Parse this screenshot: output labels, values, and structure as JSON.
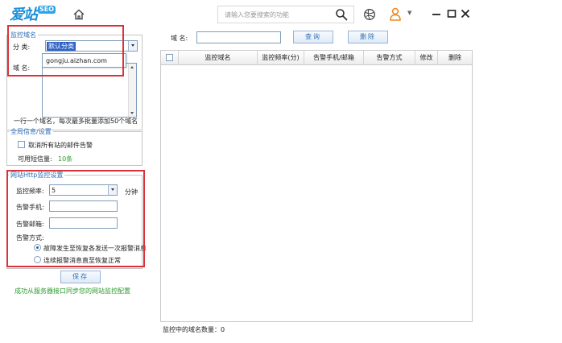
{
  "app": {
    "logo_text": "爱站",
    "logo_badge": "SEO",
    "search_placeholder": "请输入您要搜索的功能"
  },
  "left": {
    "group1": {
      "legend": "监控域名",
      "category_label": "分  类:",
      "category_value": "默认分类",
      "domain_label": "域  名:",
      "domain_suggestion": "gongju.aizhan.com",
      "hint": "一行一个域名，每次最多批量添加50个域名"
    },
    "group2": {
      "legend": "全局信息/设置",
      "cancel_alert_label": "取消所有站的邮件告警",
      "sms_label": "可用短信量:",
      "sms_value": "10条"
    },
    "group3": {
      "legend": "网站Http监控设置",
      "freq_label": "监控频率:",
      "freq_value": "5",
      "freq_unit": "分钟",
      "phone_label": "告警手机:",
      "email_label": "告警邮箱:",
      "mode_label": "告警方式:",
      "mode_option1": "故障发生至恢复各发送一次报警消息",
      "mode_option2": "连续报警消息直至恢复正常"
    },
    "save_label": "保存",
    "success_msg": "成功从服务器接口同步您的网站监控配置"
  },
  "right": {
    "filter_label": "域  名:",
    "query_label": "查询",
    "delete_label": "删除",
    "columns": [
      "监控域名",
      "监控频率(分)",
      "告警手机/邮箱",
      "告警方式",
      "修改",
      "删除"
    ],
    "status": "监控中的域名数量：0"
  }
}
